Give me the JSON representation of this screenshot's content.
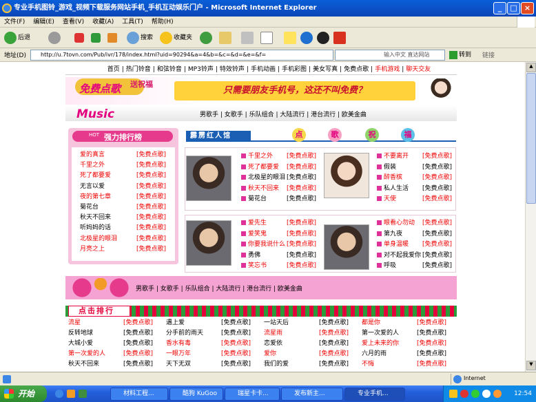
{
  "window": {
    "title": "专业手机图铃_游戏_视频下载服务网站手机_手机互动娱乐门户 - Microsoft Internet Explorer"
  },
  "menu": [
    "文件(F)",
    "编辑(E)",
    "查看(V)",
    "收藏(A)",
    "工具(T)",
    "帮助(H)"
  ],
  "toolbar": {
    "back": "后退",
    "search": "搜索",
    "favorites": "收藏夹"
  },
  "address": {
    "label": "地址(D)",
    "url": "http://u.7tovn.com/Pub/ivr/178/index.html?uid=90294&a=4&b=&c=&d=&e=&f=",
    "input_hint": "输入中文 直达网站",
    "go": "转到",
    "links": "链接"
  },
  "site": {
    "nav": [
      "首页",
      "热门铃音",
      "和弦铃音",
      "MP3铃声",
      "特效铃声",
      "手机动画",
      "手机彩图",
      "美女写真",
      "免费点歌",
      "手机游戏",
      "聊天交友"
    ],
    "banner_logo": "免费点歌",
    "banner_logo_tag": "送祝福",
    "banner_slogan": "只需要朋友手机号，这还不叫免费？",
    "music_label": "Music",
    "categories": [
      "男歌手",
      "女歌手",
      "乐队组合",
      "大陆流行",
      "港台流行",
      "欧美金曲"
    ],
    "chart_title": "强力排行榜",
    "chart_hot": "HOT",
    "chart_items": [
      {
        "song": "爱的真言",
        "red": true
      },
      {
        "song": "千里之外",
        "red": true
      },
      {
        "song": "死了都要爱",
        "red": true
      },
      {
        "song": "无言以爱",
        "red": false
      },
      {
        "song": "夜的第七章",
        "red": true
      },
      {
        "song": "菊花台",
        "red": false
      },
      {
        "song": "秋天不回来",
        "red": false
      },
      {
        "song": "听妈妈的话",
        "red": false
      },
      {
        "song": "北极星的眼泪",
        "red": true
      },
      {
        "song": "月亮之上",
        "red": true
      }
    ],
    "free_label": "[免费点歌]",
    "star_label": "霹雳红人馆",
    "blessing": [
      "点",
      "歌",
      "祝",
      "福"
    ],
    "star1_songs": [
      {
        "song": "千里之外",
        "red": true
      },
      {
        "song": "死了都要爱",
        "red": true
      },
      {
        "song": "北极星的眼泪",
        "red": false
      },
      {
        "song": "秋天不回来",
        "red": true
      },
      {
        "song": "菊花台",
        "red": false
      }
    ],
    "star2_songs": [
      {
        "song": "不要离开",
        "red": true
      },
      {
        "song": "假装",
        "red": false
      },
      {
        "song": "醉香槟",
        "red": true
      },
      {
        "song": "私人生活",
        "red": false
      },
      {
        "song": "天使",
        "red": true
      }
    ],
    "star3_songs": [
      {
        "song": "爱先生",
        "red": true
      },
      {
        "song": "爱笑鬼",
        "red": true
      },
      {
        "song": "你要我说什么",
        "red": true
      },
      {
        "song": "勇佛",
        "red": false
      },
      {
        "song": "笑忘书",
        "red": true
      }
    ],
    "star4_songs": [
      {
        "song": "眼看心勿动",
        "red": true
      },
      {
        "song": "第九夜",
        "red": false
      },
      {
        "song": "单身温暖",
        "red": true
      },
      {
        "song": "对不起我爱你",
        "red": false
      },
      {
        "song": "呼吸",
        "red": false
      }
    ],
    "band_categories": [
      "男歌手",
      "女歌手",
      "乐队组合",
      "大陆流行",
      "港台流行",
      "欧美金曲"
    ],
    "click_title": "点击排行",
    "click_rows": [
      [
        "流星",
        "遇上爱",
        "一站天后",
        "都是你"
      ],
      [
        "反转地球",
        "分手前的雨天",
        "流星雨",
        "第一次爱的人"
      ],
      [
        "大城小爱",
        "香水有毒",
        "恋爱依",
        "爱上未来的你"
      ],
      [
        "第一次爱的人",
        "一眼万年",
        "爱你",
        "六月的雨"
      ],
      [
        "秋天不回来",
        "天下无双",
        "我们的爱",
        "不悔"
      ]
    ],
    "click_red": [
      [
        true,
        false,
        false,
        true
      ],
      [
        false,
        false,
        true,
        false
      ],
      [
        false,
        true,
        false,
        true
      ],
      [
        true,
        true,
        true,
        false
      ],
      [
        false,
        false,
        false,
        true
      ]
    ]
  },
  "status": {
    "zone": "Internet"
  },
  "taskbar": {
    "start": "开始",
    "tasks": [
      "材料工程...",
      "酷狗 KuGoo",
      "瑞星卡卡...",
      "发布新主...",
      "专业手机..."
    ],
    "clock": "12:54"
  },
  "colors": {
    "accent": "#e4007f",
    "pink": "#f5a3d3",
    "title_blue": "#0b4fc5"
  }
}
